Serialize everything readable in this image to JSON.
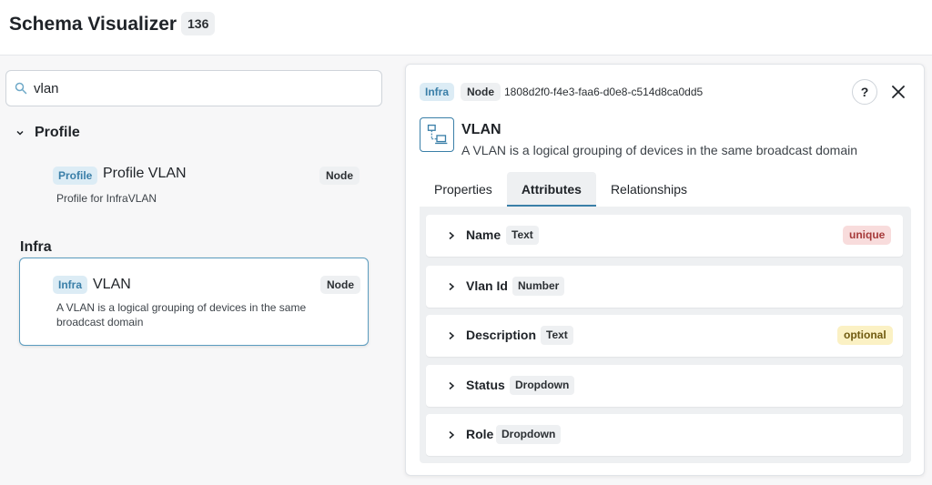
{
  "header": {
    "title": "Schema Visualizer",
    "count": "136"
  },
  "search": {
    "value": "vlan"
  },
  "groups": [
    {
      "name": "Profile"
    },
    {
      "name": "Infra"
    }
  ],
  "items": [
    {
      "namespace": "Profile",
      "name": "Profile VLAN",
      "kind": "Node",
      "description": "Profile for InfraVLAN"
    },
    {
      "namespace": "Infra",
      "name": "VLAN",
      "kind": "Node",
      "description": "A VLAN is a logical grouping of devices in the same broadcast domain"
    }
  ],
  "detail": {
    "namespace": "Infra",
    "kind": "Node",
    "id": "1808d2f0-f4e3-faa6-d0e8-c514d8ca0dd5",
    "help_label": "?",
    "title": "VLAN",
    "description": "A VLAN is a logical grouping of devices in the same broadcast domain",
    "tabs": [
      "Properties",
      "Attributes",
      "Relationships"
    ],
    "active_tab": "Attributes",
    "attributes": [
      {
        "name": "Name",
        "type": "Text",
        "flag": "unique"
      },
      {
        "name": "Vlan Id",
        "type": "Number",
        "flag": ""
      },
      {
        "name": "Description",
        "type": "Text",
        "flag": "optional"
      },
      {
        "name": "Status",
        "type": "Dropdown",
        "flag": ""
      },
      {
        "name": "Role",
        "type": "Dropdown",
        "flag": ""
      }
    ]
  },
  "colors": {
    "accent": "#3a7fa8",
    "unique_bg": "#f8dcdc",
    "optional_bg": "#fbf1c4"
  },
  "icons": [
    "search-icon",
    "chevron-down-icon",
    "help-icon",
    "close-icon",
    "schema-node-icon",
    "chevron-right-icon"
  ]
}
